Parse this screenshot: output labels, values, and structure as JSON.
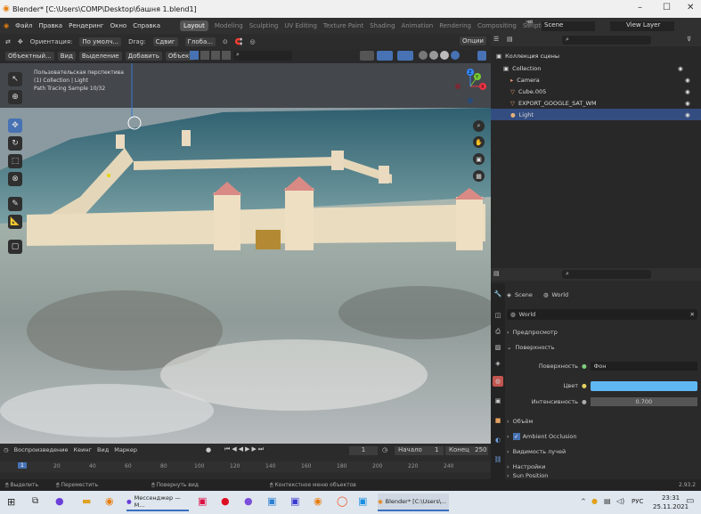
{
  "window": {
    "title": "Blender* [C:\\Users\\COMP\\Desktop\\башня 1.blend1]",
    "minimize": "–",
    "maximize": "☐",
    "close": "✕"
  },
  "menu": [
    "Файл",
    "Правка",
    "Рендеринг",
    "Окно",
    "Справка"
  ],
  "workspaces": [
    "Layout",
    "Modeling",
    "Sculpting",
    "UV Editing",
    "Texture Paint",
    "Shading",
    "Animation",
    "Rendering",
    "Compositing",
    "Scripting",
    "+"
  ],
  "scene_field": "Scene",
  "view_layer_field": "View Layer",
  "header1": {
    "orientation_label": "Ориентация:",
    "orientation_value": "По умолч...",
    "drag_label": "Drag:",
    "drag_value": "Сдвиг",
    "transform": "Глоба...",
    "options": "Опции"
  },
  "header2": {
    "mode": "Объектный...",
    "items": [
      "Вид",
      "Выделение",
      "Добавить",
      "Объект"
    ]
  },
  "viewport": {
    "overlay": [
      "Пользовательская перспектива",
      "(1) Collection | Light",
      "Path Tracing Sample 10/32"
    ],
    "axes": {
      "x": "X",
      "y": "Y",
      "z": "Z"
    }
  },
  "outliner": {
    "scene_collection": "Коллекция сцены",
    "collection": "Collection",
    "items": [
      "Camera",
      "Cube.005",
      "EXPORT_GOOGLE_SAT_WM",
      "Light"
    ],
    "selected": "Light"
  },
  "properties": {
    "scene": "Scene",
    "world_tab": "World",
    "world_name": "World",
    "panels": [
      "Предпросмотр",
      "Поверхность"
    ],
    "surface_label": "Поверхность",
    "surface_value": "Фон",
    "color_label": "Цвет",
    "color_hex": "#5fb8f2",
    "strength_label": "Интенсивность",
    "strength_value": "0.700",
    "subpanels": [
      "Объём",
      "Ambient Occlusion",
      "Видимость лучей",
      "Настройки",
      "Sun Position"
    ],
    "ao_checked": true
  },
  "timeline": {
    "menu": [
      "Воспроизведение",
      "Кеинг",
      "Вид",
      "Маркер"
    ],
    "current_frame": "1",
    "start_label": "Начало",
    "start": "1",
    "end_label": "Конец",
    "end": "250",
    "ticks": [
      "1",
      "20",
      "40",
      "60",
      "80",
      "100",
      "120",
      "140",
      "160",
      "180",
      "200",
      "220",
      "240"
    ]
  },
  "statusbar": [
    "Выделить",
    "Переместить",
    "Повернуть вид",
    "Контекстное меню объектов"
  ],
  "version": "2.93.2",
  "taskbar": {
    "messenger": "Мессенджер — M...",
    "blender": "Blender* [C:\\Users\\...",
    "lang": "РУС",
    "time": "23:31",
    "date": "25.11.2021"
  }
}
